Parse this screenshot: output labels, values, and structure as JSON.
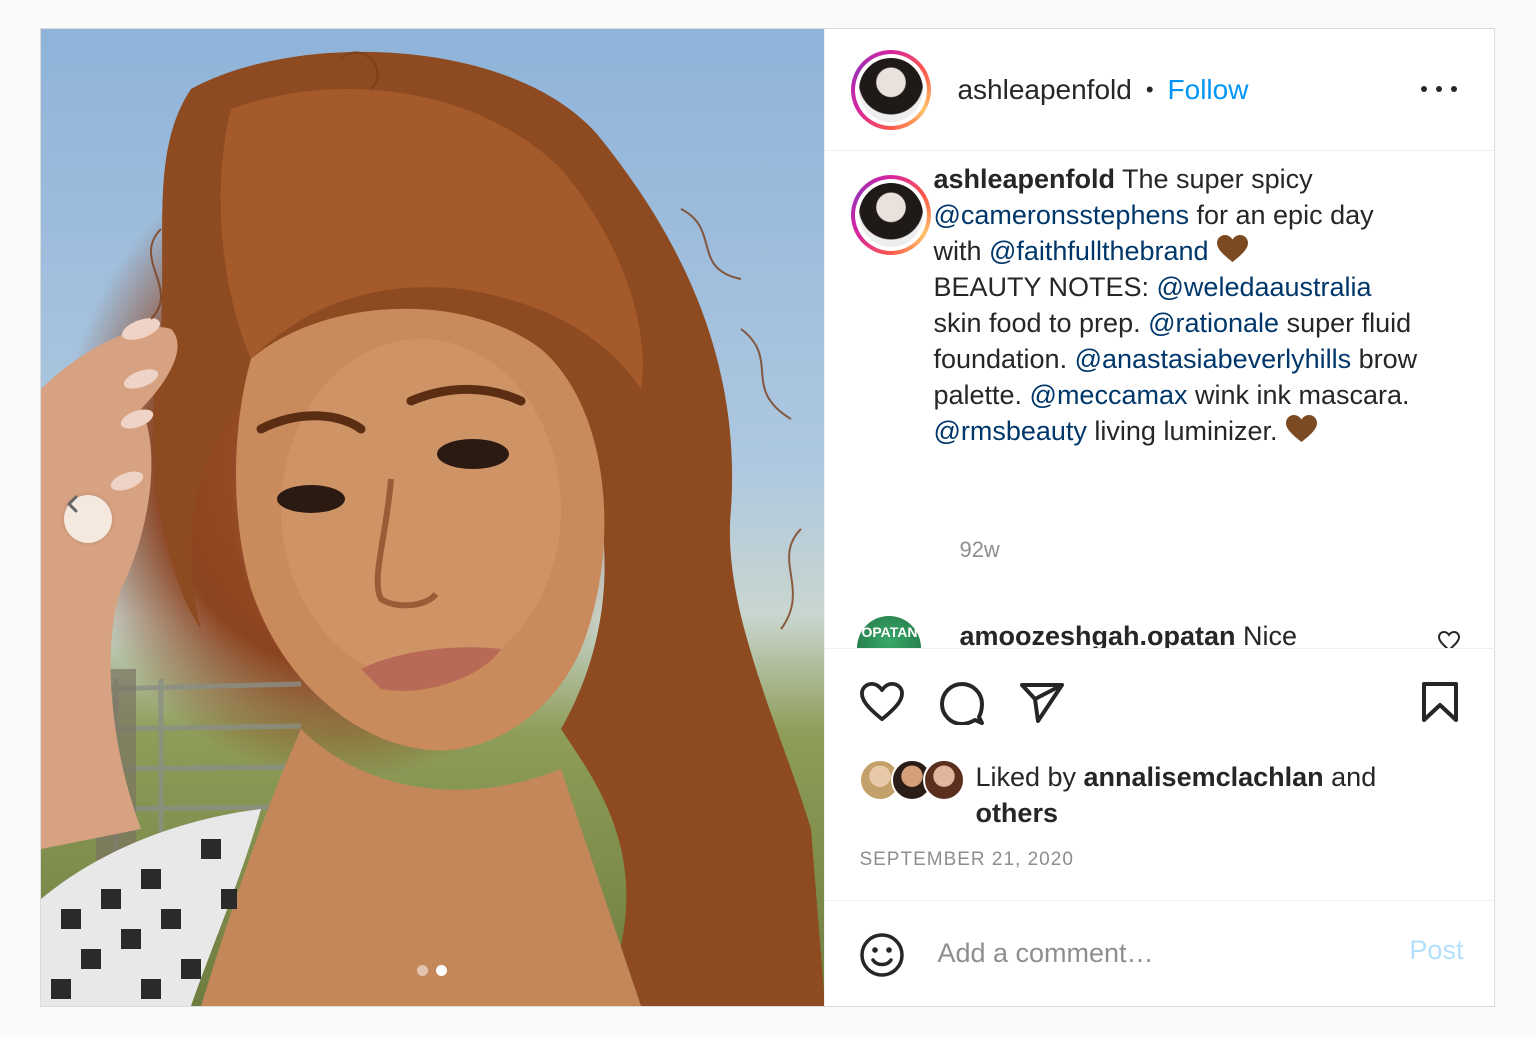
{
  "post": {
    "username": "ashleapenfold",
    "separator": "•",
    "follow_label": "Follow",
    "more_icon": "more-horizontal-icon"
  },
  "media": {
    "description": "Selfie photo",
    "carousel_prev_icon": "chevron-left-icon",
    "slide_count": 2,
    "active_slide": 2
  },
  "caption": {
    "username": "ashleapenfold",
    "segments": [
      {
        "t": " The super spicy "
      },
      {
        "m": "@cameronsstephens"
      },
      {
        "t": " for an epic day with "
      },
      {
        "m": "@faithfullthebrand"
      },
      {
        "e": "brown-heart"
      },
      {
        "br": true
      },
      {
        "t": "BEAUTY NOTES: "
      },
      {
        "m": "@weledaaustralia"
      },
      {
        "t": " skin food to prep. "
      },
      {
        "m": "@rationale"
      },
      {
        "t": " super fluid foundation. "
      },
      {
        "m": "@anastasiabeverlyhills"
      },
      {
        "t": " brow palette. "
      },
      {
        "m": "@meccamax"
      },
      {
        "t": " wink ink mascara. "
      },
      {
        "m": "@rmsbeauty"
      },
      {
        "t": " living luminizer. "
      },
      {
        "e": "brown-heart"
      }
    ],
    "time": "92w"
  },
  "comment_preview": {
    "avatar_text": "OPATAN",
    "username": "amoozeshgah.opatan",
    "text": "Nice"
  },
  "actions": {
    "like_icon": "heart-icon",
    "comment_icon": "comment-icon",
    "share_icon": "paper-plane-icon",
    "save_icon": "bookmark-icon"
  },
  "likes": {
    "prefix": "Liked by ",
    "user": "annalisemclachlan",
    "middle": " and ",
    "others": "others"
  },
  "date": "SEPTEMBER 21, 2020",
  "add_comment": {
    "placeholder": "Add a comment…",
    "post_label": "Post",
    "emoji_icon": "smiley-icon"
  },
  "colors": {
    "link": "#0095f6",
    "mention": "#00376b",
    "muted": "#8e8e8e",
    "post_disabled": "#b2dffc"
  }
}
